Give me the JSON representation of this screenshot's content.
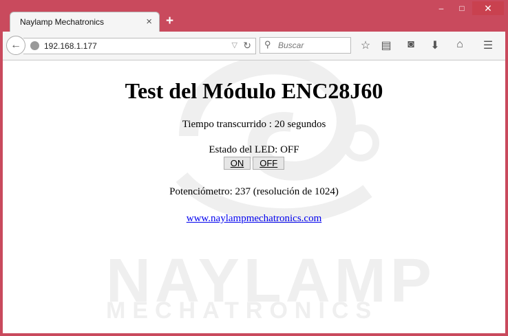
{
  "browser": {
    "tab_title": "Naylamp Mechatronics",
    "tab_close": "×",
    "new_tab": "+",
    "url": "192.168.1.177",
    "search_placeholder": "Buscar",
    "window_controls": {
      "minimize": "–",
      "maximize": "□",
      "close": "✕"
    }
  },
  "icons": {
    "back": "back-arrow-icon",
    "reload": "reload-icon",
    "star": "bookmark-star-icon",
    "reading": "reading-list-icon",
    "pocket": "pocket-icon",
    "download": "download-icon",
    "home": "home-icon",
    "menu": "hamburger-menu-icon"
  },
  "page": {
    "title": "Test del Módulo ENC28J60",
    "elapsed": "Tiempo transcurrido : 20 segundos",
    "led_state": "Estado del LED: OFF",
    "btn_on": "ON",
    "btn_off": "OFF",
    "pot": "Potenciómetro: 237 (resolución de 1024)",
    "link": "www.naylampmechatronics.com"
  },
  "watermark": {
    "big": "NAYLAMP",
    "small": "MECHATRONICS"
  },
  "colors": {
    "frame": "#c94a5d",
    "link": "#0000ee"
  }
}
